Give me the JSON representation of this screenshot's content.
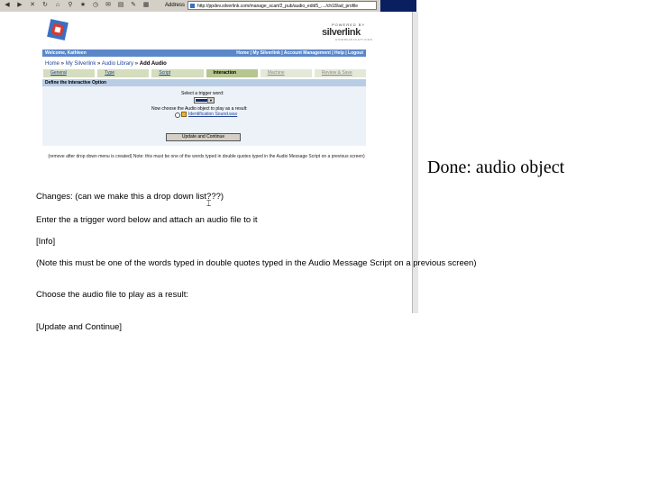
{
  "browser": {
    "address_label": "Address",
    "url": "http://ppdev.silverlink.com/manage_scart/2_pub/audio_edit/5_..../ch18/ad_profile"
  },
  "page": {
    "brand": {
      "powered_by": "POWERED BY",
      "name": "silverlink",
      "tagline": "COMMUNICATIONS"
    },
    "nav": {
      "welcome": "Welcome, Kathleen",
      "links": "Home | My Silverlink | Account Management | Help | Logout"
    },
    "breadcrumb": {
      "home": "Home",
      "my_silverlink": "My Silverlink",
      "audio_library": "Audio Library",
      "current": "Add Audio",
      "sep": " » "
    },
    "steps": [
      "General",
      "Type",
      "Script",
      "Interaction",
      "Machine",
      "Review & Save"
    ],
    "section_title": "Define the Interactive Option",
    "form": {
      "trigger_label": "Select a trigger word:",
      "choose_label": "Now choose the Audio object to play as a result:",
      "file_option": "Identification Sound.wav",
      "update_button": "Update and Continue"
    },
    "note": "(remove after drop down menu is created) Note: this must be one of the words typed in double quotes typed in the Audio Message Script on a previous screen)"
  },
  "slide": {
    "done_title": "Done: audio object",
    "changes": "Changes: (can we make this a drop down list???)",
    "enter_trigger": "Enter the a trigger word below and attach an audio file to it",
    "info": "[Info]",
    "note": "(Note this must be one of the words typed in double quotes typed in the Audio Message Script on a previous screen)",
    "choose": "Choose the audio file to play as a result:",
    "update": "[Update and Continue]"
  },
  "colors": {
    "nav_blue": "#5b87c9",
    "section_blue": "#b8cde4",
    "step_green": "#d4ddbd",
    "link_blue": "#23449a"
  }
}
